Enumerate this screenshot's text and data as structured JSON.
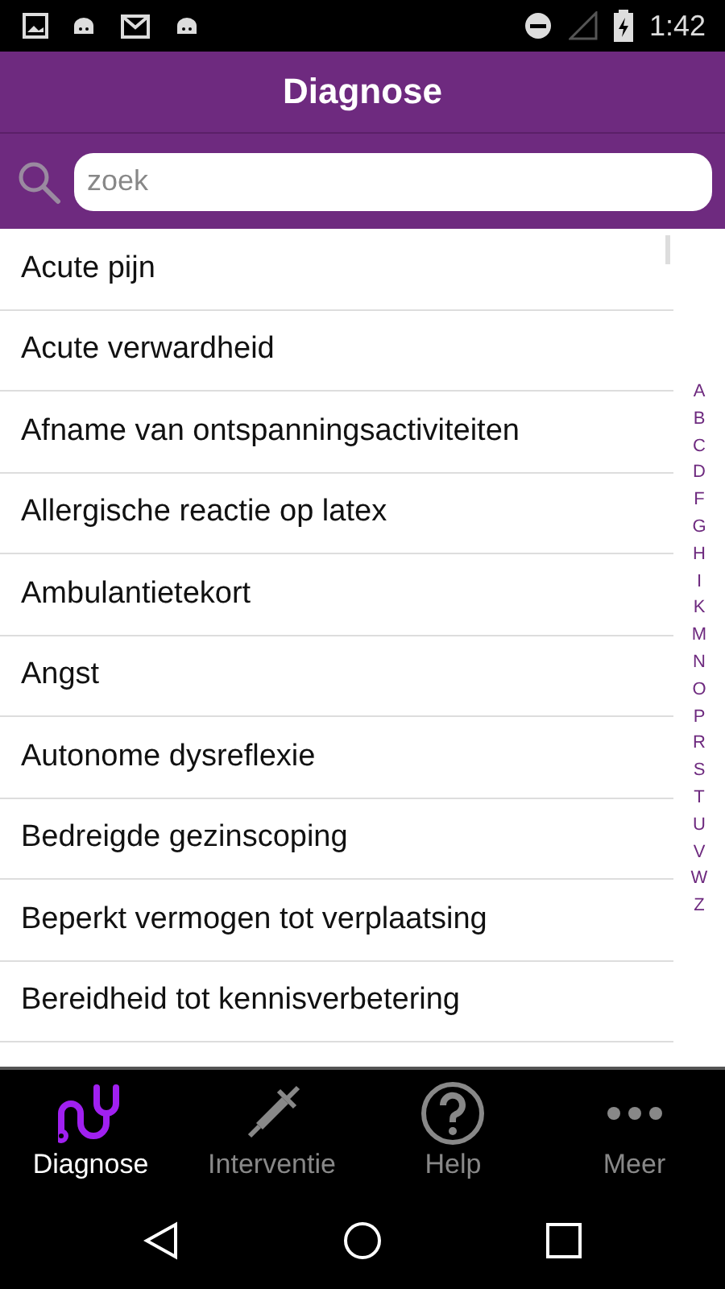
{
  "status_bar": {
    "time": "1:42"
  },
  "header": {
    "title": "Diagnose"
  },
  "search": {
    "placeholder": "zoek"
  },
  "items": [
    "Acute pijn",
    "Acute verwardheid",
    "Afname van ontspanningsactiviteiten",
    "Allergische reactie op latex",
    "Ambulantietekort",
    "Angst",
    "Autonome dysreflexie",
    "Bedreigde gezinscoping",
    "Beperkt vermogen tot verplaatsing",
    "Bereidheid tot kennisverbetering"
  ],
  "index_letters": [
    "A",
    "B",
    "C",
    "D",
    "F",
    "G",
    "H",
    "I",
    "K",
    "M",
    "N",
    "O",
    "P",
    "R",
    "S",
    "T",
    "U",
    "V",
    "W",
    "Z"
  ],
  "tabs": [
    {
      "label": "Diagnose",
      "kind": "stethoscope",
      "selected": true
    },
    {
      "label": "Interventie",
      "kind": "syringe",
      "selected": false
    },
    {
      "label": "Help",
      "kind": "help",
      "selected": false
    },
    {
      "label": "Meer",
      "kind": "more",
      "selected": false
    }
  ]
}
